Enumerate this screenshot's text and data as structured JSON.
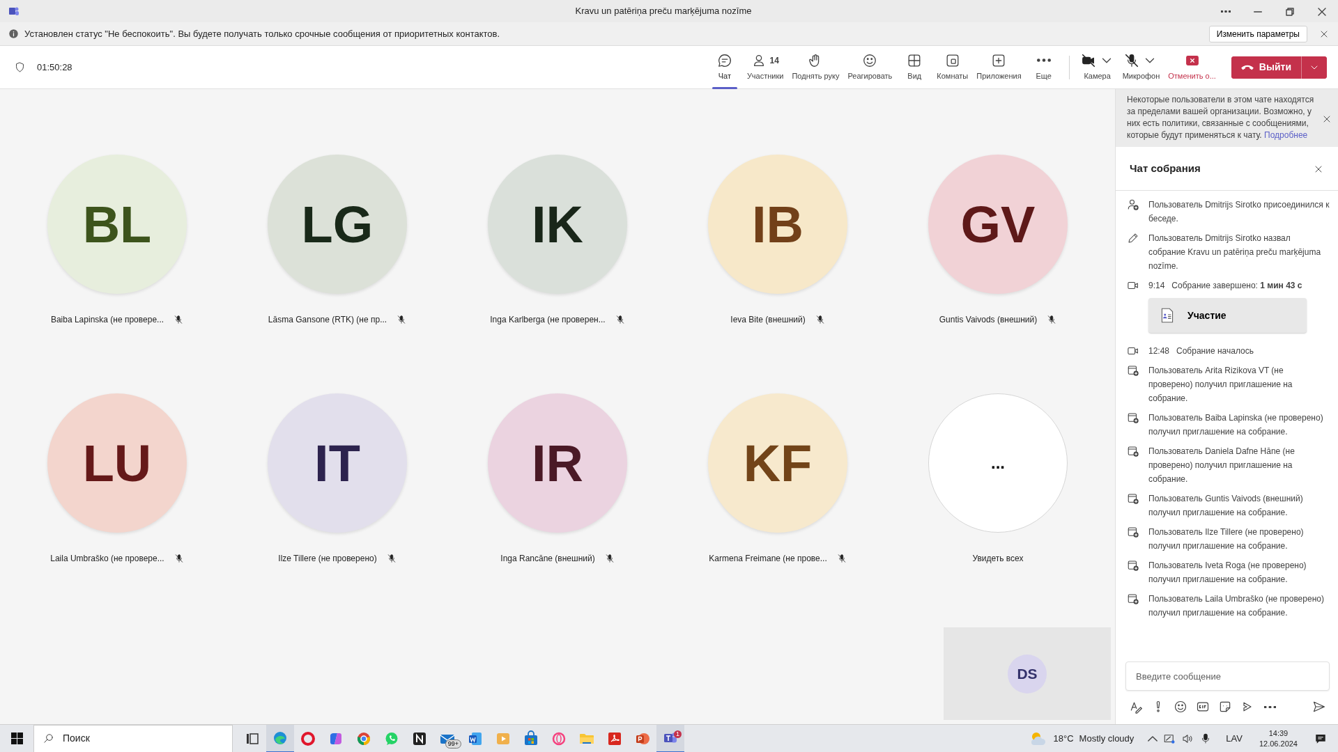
{
  "window": {
    "title": "Kravu un patēriņa preču marķējuma nozīme"
  },
  "notice": {
    "text": "Установлен статус \"Не беспокоить\". Вы будете получать только срочные сообщения от приоритетных контактов.",
    "button": "Изменить параметры"
  },
  "toolbar": {
    "timer": "01:50:28",
    "items": [
      {
        "kind": "chat",
        "label": "Чат",
        "selected": true
      },
      {
        "kind": "people",
        "label": "Участники",
        "count": "14",
        "selected": false
      },
      {
        "kind": "hand",
        "label": "Поднять руку",
        "selected": false
      },
      {
        "kind": "react",
        "label": "Реагировать",
        "selected": false
      },
      {
        "kind": "view",
        "label": "Вид",
        "selected": false
      },
      {
        "kind": "rooms",
        "label": "Комнаты",
        "selected": false
      },
      {
        "kind": "apps",
        "label": "Приложения",
        "selected": false
      },
      {
        "kind": "more",
        "label": "Еще",
        "selected": false
      }
    ],
    "devices": [
      {
        "kind": "camera",
        "label": "Камера",
        "on": false
      },
      {
        "kind": "mic",
        "label": "Микрофон",
        "on": false
      }
    ],
    "share": {
      "label": "Отменить о..."
    },
    "leave": {
      "label": "Выйти"
    }
  },
  "participants": [
    {
      "kind": "person",
      "initials": "BL",
      "name": "Baiba Lapinska (не провере...",
      "color": "#e7eedd",
      "muted": true
    },
    {
      "kind": "person",
      "initials": "LG",
      "name": "Lāsma Gansone (RTK) (не пр...",
      "color": "#dce1d8",
      "muted": true
    },
    {
      "kind": "person",
      "initials": "IK",
      "name": "Inga Karlberga (не проверен...",
      "color": "#dae0da",
      "muted": true
    },
    {
      "kind": "person",
      "initials": "IB",
      "name": "Ieva Bite (внешний)",
      "color": "#f7e8c9",
      "muted": true
    },
    {
      "kind": "person",
      "initials": "GV",
      "name": "Guntis Vaivods (внешний)",
      "color": "#f1d2d6",
      "muted": true
    },
    {
      "kind": "person",
      "initials": "LU",
      "name": "Laila Umbraško (не провере...",
      "color": "#f3d5cd",
      "muted": true
    },
    {
      "kind": "person",
      "initials": "IT",
      "name": "Ilze Tillere (не проверено)",
      "color": "#e2dfec",
      "muted": true
    },
    {
      "kind": "person",
      "initials": "IR",
      "name": "Inga Rancāne (внешний)",
      "color": "#ebd3e0",
      "muted": true
    },
    {
      "kind": "person",
      "initials": "KF",
      "name": "Karmena Freimane (не прове...",
      "color": "#f7e9cd",
      "muted": true
    },
    {
      "kind": "more",
      "initials": "...",
      "name": "Увидеть всех"
    }
  ],
  "self_preview": {
    "initials": "DS"
  },
  "chat": {
    "banner": {
      "text": "Некоторые пользователи в этом чате находятся за пределами вашей организации. Возможно, у них есть политики, связанные с сообщениями, которые будут применяться к чату.",
      "link": "Подробнее"
    },
    "title": "Чат собрания",
    "events": [
      {
        "kind": "join",
        "text": "Пользователь Dmitrijs Sirotko присоединился к беседе."
      },
      {
        "kind": "rename",
        "text": "Пользователь Dmitrijs Sirotko назвал собрание Kravu un patēriņa preču marķējuma nozīme."
      },
      {
        "kind": "ended",
        "time": "9:14",
        "text": "Собрание завершено: **1 мин 43 с**",
        "card": "Участие"
      },
      {
        "kind": "started",
        "time": "12:48",
        "text": "Собрание началось"
      },
      {
        "kind": "invite",
        "text": "Пользователь Arita Rizikova VT (не проверено) получил приглашение на собрание."
      },
      {
        "kind": "invite",
        "text": "Пользователь Baiba Lapinska (не проверено) получил приглашение на собрание."
      },
      {
        "kind": "invite",
        "text": "Пользователь Daniela Dafne Hāne (не проверено) получил приглашение на собрание."
      },
      {
        "kind": "invite",
        "text": "Пользователь Guntis Vaivods (внешний) получил приглашение на собрание."
      },
      {
        "kind": "invite",
        "text": "Пользователь Ilze Tillere (не проверено) получил приглашение на собрание."
      },
      {
        "kind": "invite",
        "text": "Пользователь Iveta Roga (не проверено) получил приглашение на собрание."
      },
      {
        "kind": "invite",
        "text": "Пользователь Laila Umbraško (не проверено) получил приглашение на собрание."
      }
    ],
    "composer": {
      "placeholder": "Введите сообщение"
    }
  },
  "taskbar": {
    "search": {
      "placeholder": "Поиск"
    },
    "apps": [
      {
        "kind": "taskview",
        "active": false
      },
      {
        "kind": "edge",
        "active": true
      },
      {
        "kind": "opera",
        "active": false
      },
      {
        "kind": "copilot",
        "active": false
      },
      {
        "kind": "chrome",
        "active": false
      },
      {
        "kind": "whatsapp",
        "active": false
      },
      {
        "kind": "notes",
        "active": false
      },
      {
        "kind": "mail",
        "active": false,
        "badge": "99+"
      },
      {
        "kind": "word",
        "active": false
      },
      {
        "kind": "video",
        "active": false
      },
      {
        "kind": "store",
        "active": false
      },
      {
        "kind": "operagx",
        "active": false
      },
      {
        "kind": "folder",
        "active": false
      },
      {
        "kind": "pdf",
        "active": false
      },
      {
        "kind": "slides",
        "active": false
      },
      {
        "kind": "teams",
        "active": true,
        "badge": "1"
      }
    ],
    "weather": {
      "temp": "18°C",
      "text": "Mostly cloudy"
    },
    "language": "LAV",
    "time": "14:39",
    "date": "12.06.2024"
  }
}
